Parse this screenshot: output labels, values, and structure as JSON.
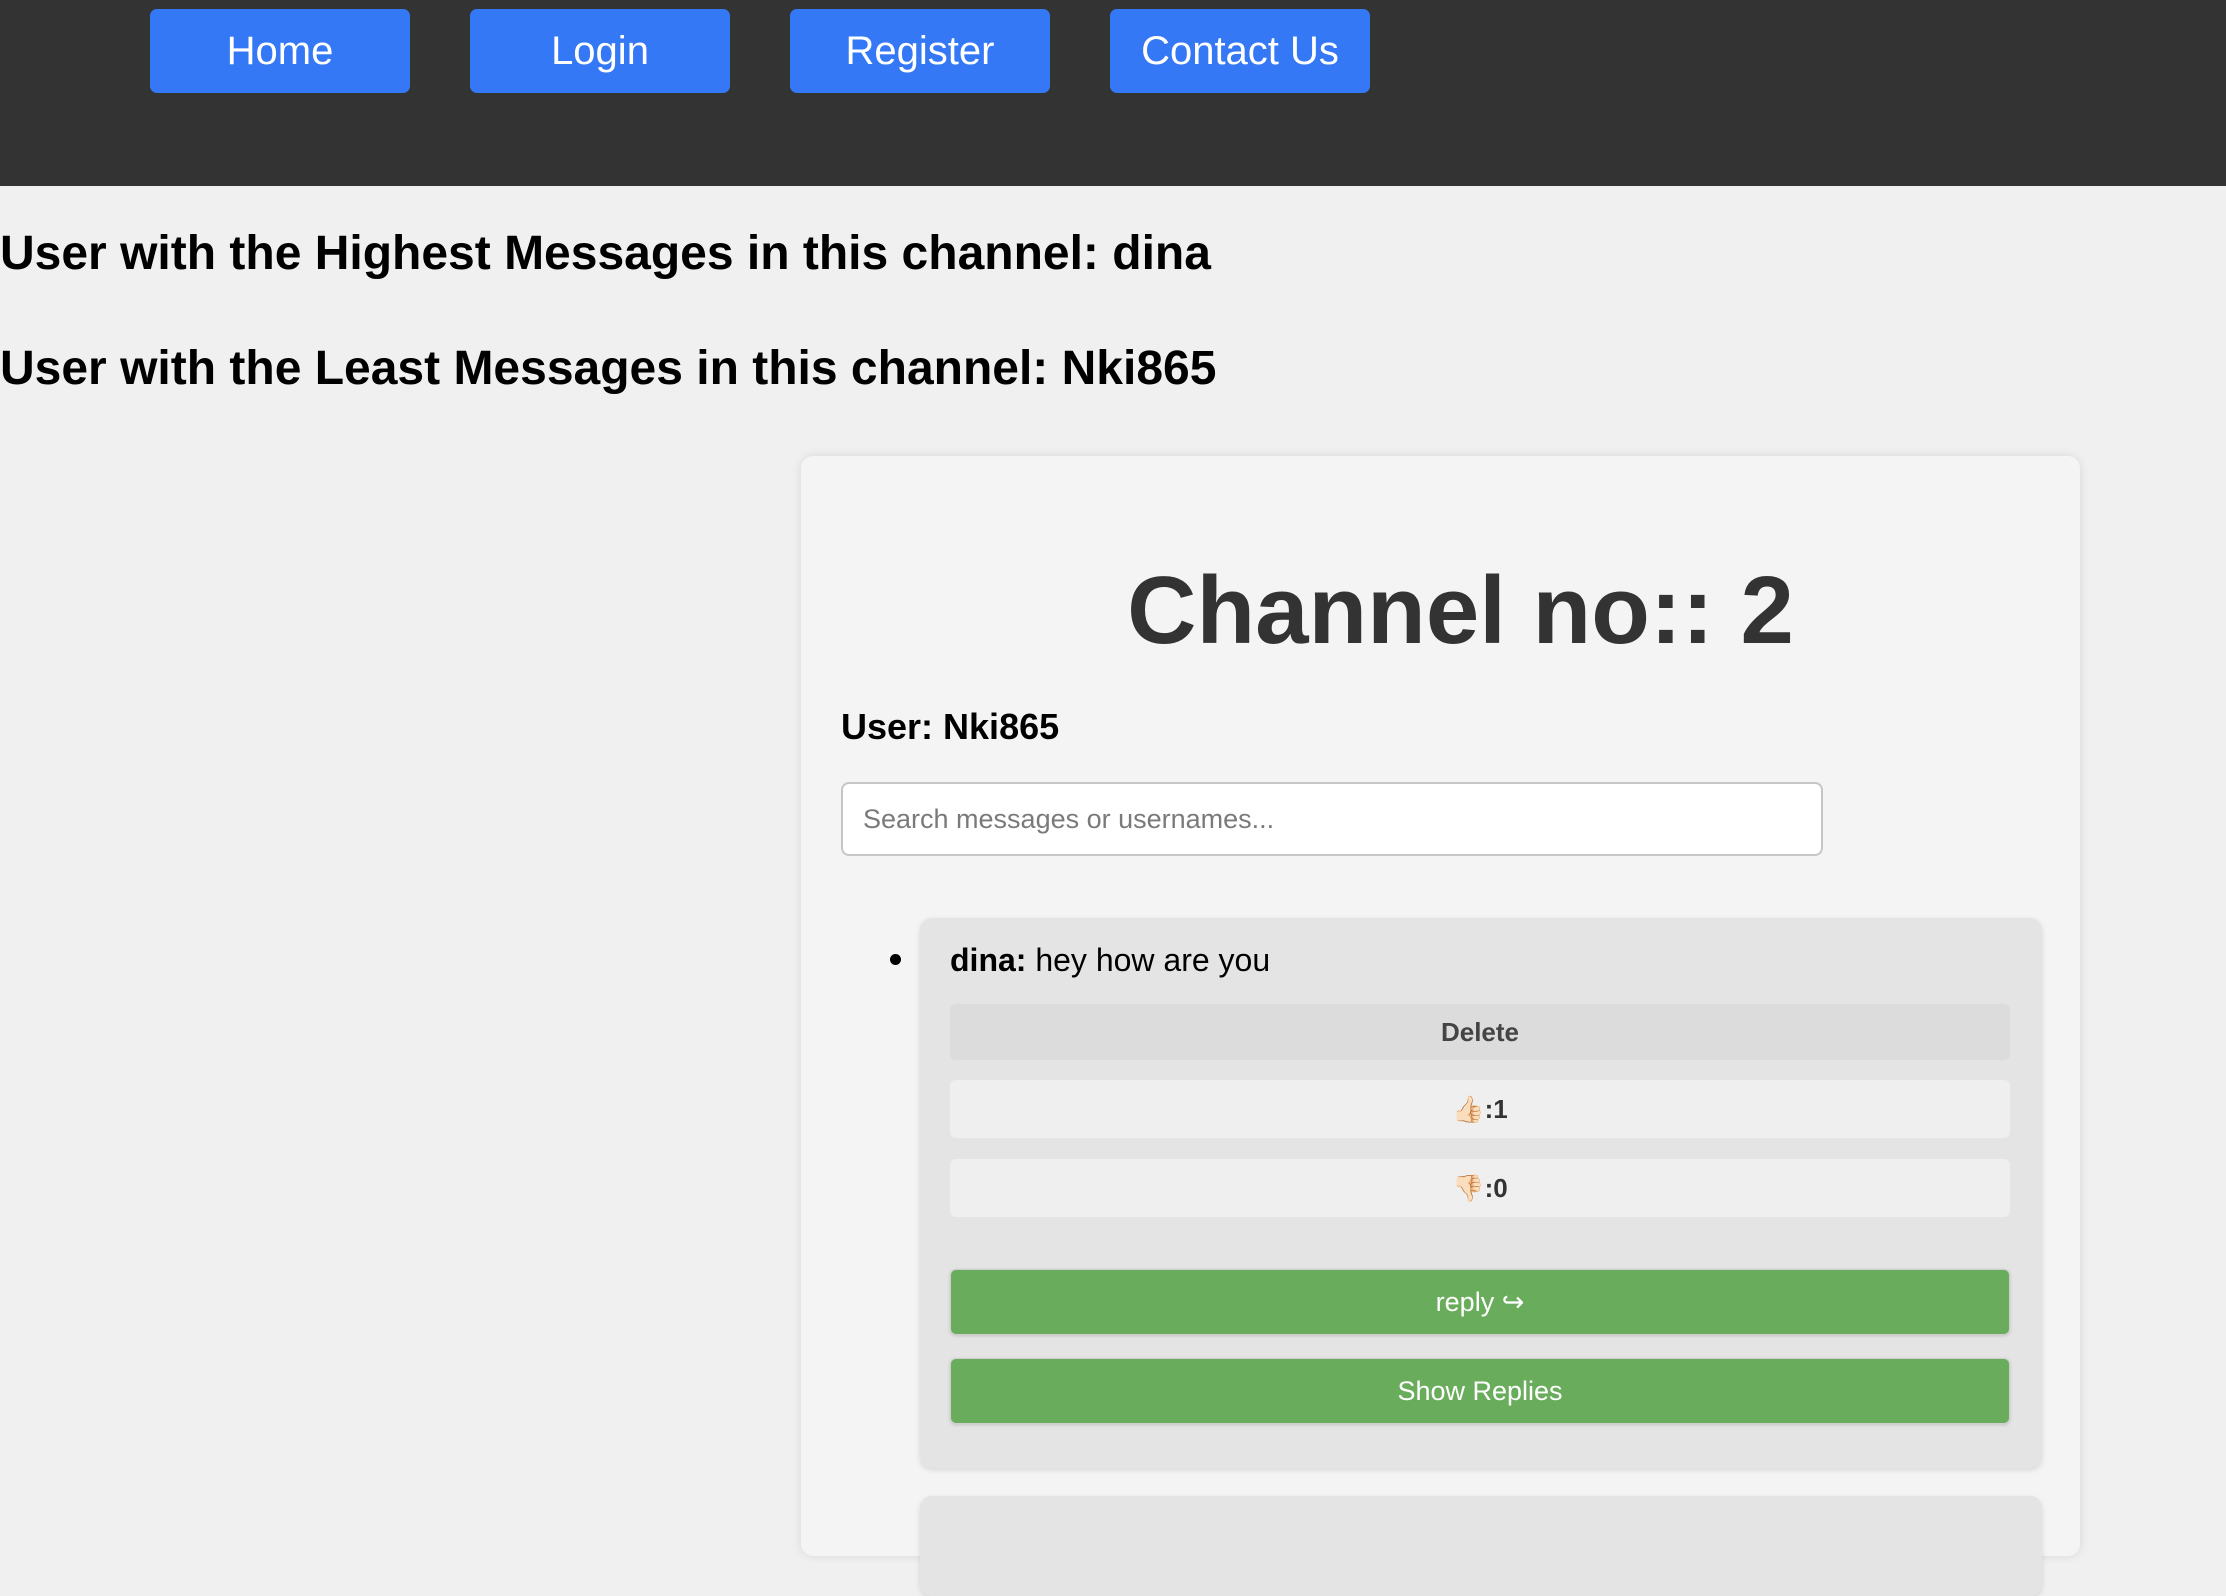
{
  "nav": {
    "home": "Home",
    "login": "Login",
    "register": "Register",
    "contact": "Contact Us"
  },
  "stats": {
    "highest_prefix": "User with the Highest Messages in this channel: ",
    "highest_user": "dina",
    "least_prefix": "User with the Least Messages in this channel: ",
    "least_user": "Nki865"
  },
  "channel": {
    "title": "Channel no:: 2",
    "user_label": "User: Nki865",
    "search_placeholder": "Search messages or usernames..."
  },
  "messages": [
    {
      "author": "dina:",
      "text": " hey how are you",
      "delete_label": "Delete",
      "like_label": "👍🏻:1",
      "likes": 1,
      "dislike_label": "👎🏻:0",
      "dislikes": 0,
      "reply_label": "reply ↪",
      "show_replies_label": "Show Replies"
    }
  ],
  "colors": {
    "navbar": "#333333",
    "nav_button": "#3478f6",
    "green_button": "#69ad5c",
    "card": "#f4f4f4",
    "message_bg": "#e4e4e4"
  }
}
